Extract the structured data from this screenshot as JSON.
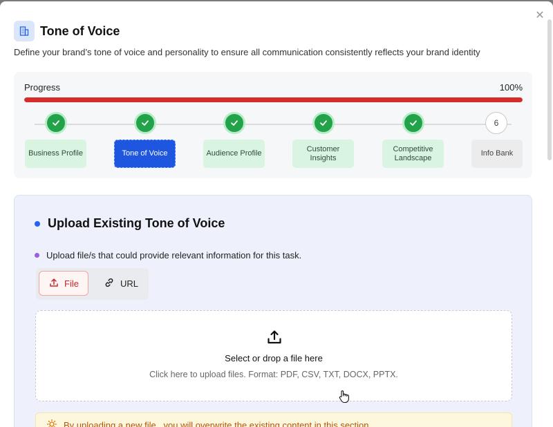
{
  "header": {
    "title": "Tone of Voice",
    "subtitle": "Define your brand’s tone of voice and personality to ensure all communication consistently reflects your brand identity",
    "icon": "building-icon",
    "close_icon": "close-icon"
  },
  "progress": {
    "label": "Progress",
    "percent_text": "100%",
    "value": 100,
    "color": "#d62b2b"
  },
  "steps": [
    {
      "label": "Business Profile",
      "status": "done"
    },
    {
      "label": "Tone of Voice",
      "status": "active"
    },
    {
      "label": "Audience Profile",
      "status": "done"
    },
    {
      "label": "Customer Insights",
      "status": "done"
    },
    {
      "label": "Competitive Landscape",
      "status": "done"
    },
    {
      "label": "Info Bank",
      "status": "todo",
      "number": "6"
    }
  ],
  "upload": {
    "title": "Upload Existing Tone of Voice",
    "instruction": "Upload file/s that could provide relevant information for this task.",
    "tabs": [
      {
        "label": "File",
        "icon": "upload-icon",
        "selected": true
      },
      {
        "label": "URL",
        "icon": "link-icon",
        "selected": false
      }
    ],
    "dropzone": {
      "title": "Select or drop a file here",
      "hint": "Click here to upload files. Format: PDF, CSV, TXT, DOCX, PPTX."
    },
    "warning": "By uploading a new file , you will overwrite the existing content in this section"
  },
  "colors": {
    "accent": "#1f56e0",
    "success": "#22a34a",
    "danger": "#c62828",
    "warning": "#b45309"
  }
}
